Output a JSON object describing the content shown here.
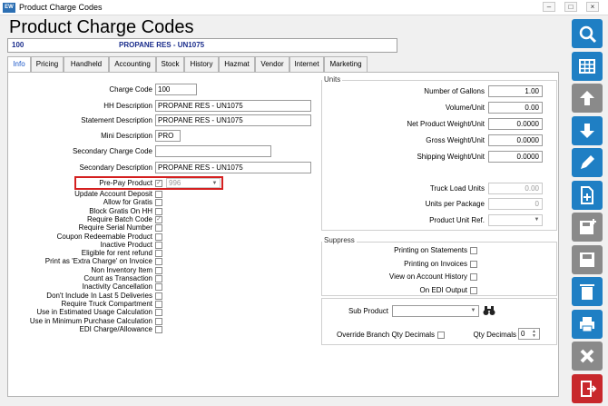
{
  "window": {
    "title": "Product Charge Codes",
    "app_icon": "app-logo-icon",
    "controls": [
      "minimize-icon",
      "maximize-icon",
      "close-icon"
    ]
  },
  "heading": "Product Charge Codes",
  "code_bar": {
    "code": "100",
    "description": "PROPANE RES - UN1075"
  },
  "tabs": [
    "Info",
    "Pricing",
    "Handheld",
    "Accounting",
    "Stock",
    "History",
    "Hazmat",
    "Vendor",
    "Internet",
    "Marketing"
  ],
  "active_tab": "Info",
  "fields": {
    "charge_code": {
      "label": "Charge Code",
      "value": "100"
    },
    "hh_description": {
      "label": "HH Description",
      "value": "PROPANE RES - UN1075"
    },
    "statement_description": {
      "label": "Statement Description",
      "value": "PROPANE RES - UN1075"
    },
    "mini_description": {
      "label": "Mini Description",
      "value": "PRO"
    },
    "secondary_charge_code": {
      "label": "Secondary Charge Code",
      "value": ""
    },
    "secondary_description": {
      "label": "Secondary Description",
      "value": "PROPANE RES - UN1075"
    },
    "pre_pay_product": {
      "label": "Pre-Pay Product",
      "checked": true,
      "value": "996"
    }
  },
  "checkboxes": [
    {
      "label": "Update Account Deposit",
      "checked": false
    },
    {
      "label": "Allow for Gratis",
      "checked": false
    },
    {
      "label": "Block Gratis On HH",
      "checked": false
    },
    {
      "label": "Require Batch Code",
      "checked": true
    },
    {
      "label": "Require Serial Number",
      "checked": false
    },
    {
      "label": "Coupon Redeemable Product",
      "checked": false
    },
    {
      "label": "Inactive Product",
      "checked": false
    },
    {
      "label": "Eligible for rent refund",
      "checked": false
    },
    {
      "label": "Print as 'Extra Charge' on Invoice",
      "checked": false
    },
    {
      "label": "Non Inventory Item",
      "checked": false
    },
    {
      "label": "Count as Transaction",
      "checked": false
    },
    {
      "label": "Inactivity Cancellation",
      "checked": false
    },
    {
      "label": "Don't Include In Last 5 Deliveries",
      "checked": false
    },
    {
      "label": "Require Truck Compartment",
      "checked": false
    },
    {
      "label": "Use in Estimated Usage Calculation",
      "checked": false
    },
    {
      "label": "Use in Minimum Purchase Calculation",
      "checked": false
    },
    {
      "label": "EDI Charge/Allowance",
      "checked": false
    }
  ],
  "units": {
    "title": "Units",
    "rows": [
      {
        "label": "Number of Gallons",
        "value": "1.00"
      },
      {
        "label": "Volume/Unit",
        "value": "0.00"
      },
      {
        "label": "Net Product Weight/Unit",
        "value": "0.0000"
      },
      {
        "label": "Gross Weight/Unit",
        "value": "0.0000"
      },
      {
        "label": "Shipping Weight/Unit",
        "value": "0.0000"
      }
    ],
    "truck_load_units": {
      "label": "Truck Load Units",
      "value": "0.00"
    },
    "units_per_package": {
      "label": "Units per Package",
      "value": "0"
    },
    "product_unit_ref": {
      "label": "Product Unit Ref.",
      "value": ""
    }
  },
  "suppress": {
    "title": "Suppress",
    "items": [
      {
        "label": "Printing on Statements",
        "checked": false
      },
      {
        "label": "Printing on Invoices",
        "checked": false
      },
      {
        "label": "View on Account History",
        "checked": false
      },
      {
        "label": "On EDI Output",
        "checked": false
      }
    ]
  },
  "sub_product": {
    "label": "Sub Product",
    "value": "",
    "search_icon": "binoculars-icon"
  },
  "override_branch": {
    "label": "Override Branch Qty Decimals",
    "checked": false
  },
  "qty_decimals": {
    "label": "Qty Decimals",
    "value": "0"
  },
  "sidebar_buttons": [
    {
      "name": "search-button",
      "icon": "search-icon",
      "color": "#1f7fc4"
    },
    {
      "name": "grid-button",
      "icon": "grid-icon",
      "color": "#1f7fc4"
    },
    {
      "name": "up-button",
      "icon": "arrow-up-icon",
      "color": "#8a8a8a"
    },
    {
      "name": "down-button",
      "icon": "arrow-down-icon",
      "color": "#1f7fc4"
    },
    {
      "name": "edit-button",
      "icon": "pencil-icon",
      "color": "#1f7fc4"
    },
    {
      "name": "new-button",
      "icon": "new-document-icon",
      "color": "#1f7fc4"
    },
    {
      "name": "save-new-button",
      "icon": "save-plus-icon",
      "color": "#8a8a8a"
    },
    {
      "name": "save-button",
      "icon": "save-icon",
      "color": "#8a8a8a"
    },
    {
      "name": "delete-button",
      "icon": "trash-icon",
      "color": "#1f7fc4"
    },
    {
      "name": "print-button",
      "icon": "printer-icon",
      "color": "#1f7fc4"
    },
    {
      "name": "cancel-button",
      "icon": "x-icon",
      "color": "#8a8a8a"
    },
    {
      "name": "exit-button",
      "icon": "exit-door-icon",
      "color": "#c8282c"
    }
  ]
}
